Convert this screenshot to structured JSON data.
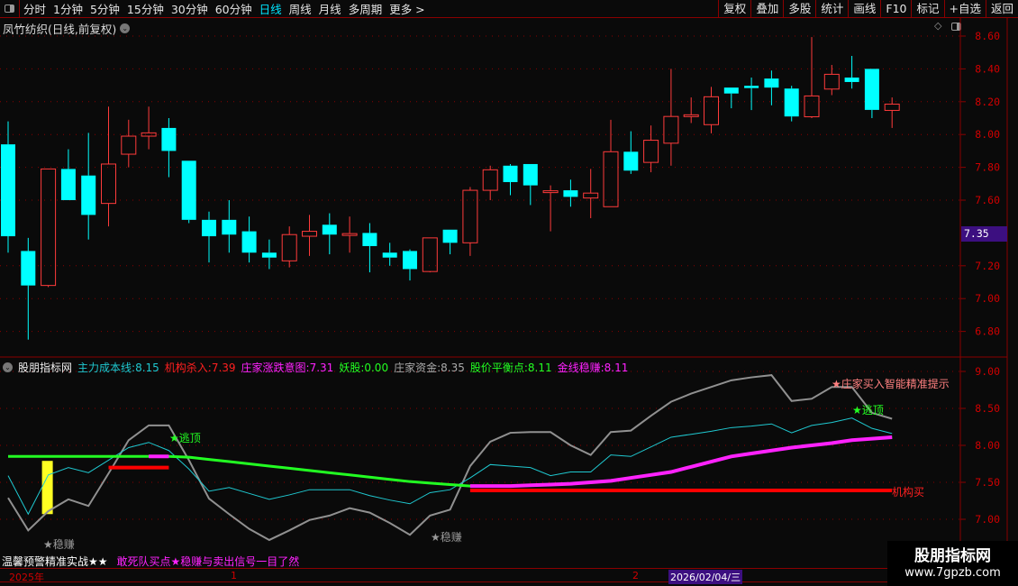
{
  "toolbar": {
    "periods": [
      "分时",
      "1分钟",
      "5分钟",
      "15分钟",
      "30分钟",
      "60分钟",
      "日线",
      "周线",
      "月线",
      "多周期",
      "更多 >"
    ],
    "active_period": "日线",
    "buttons": [
      "复权",
      "叠加",
      "多股",
      "统计",
      "画线",
      "F10",
      "标记",
      "+自选",
      "返回"
    ]
  },
  "chart_title": "凤竹纺织(日线,前复权)",
  "current_price_label": "7.35",
  "colors": {
    "up": "#ff3b3b",
    "down": "#00ffff",
    "grid": "#8a0000",
    "axis_text": "#d00000"
  },
  "indicator": {
    "name": "股朋指标网",
    "readouts": [
      {
        "label": "主力成本线:",
        "value": "8.15",
        "color": "#1fc8d0"
      },
      {
        "label": "机构杀入:",
        "value": "7.39",
        "color": "#ff2020"
      },
      {
        "label": "庄家涨跌意图:",
        "value": "7.31",
        "color": "#ff22ff"
      },
      {
        "label": "妖股:",
        "value": "0.00",
        "color": "#22ff22"
      },
      {
        "label": "庄家资金:",
        "value": "8.35",
        "color": "#aaaaaa"
      },
      {
        "label": "股价平衡点:",
        "value": "8.11",
        "color": "#22ff22"
      },
      {
        "label": "金线稳赚:",
        "value": "8.11",
        "color": "#ff22ff"
      }
    ],
    "annotations": {
      "escape_top_1": "★逃顶",
      "escape_top_2": "★逃顶",
      "steady_1": "★稳赚",
      "steady_2": "★稳赚",
      "banker_buy": "★庄家买入智能精准提示",
      "inst_buy": "机构买"
    }
  },
  "bottom": {
    "left": "温馨预警精准实战★★",
    "right": "敢死队买点★稳赚与卖出信号一目了然"
  },
  "timeline": {
    "year": "2025年",
    "m1": "1",
    "m2": "2",
    "cursor_date": "2026/02/04/三"
  },
  "watermark": {
    "name": "股朋指标网",
    "url": "www.7gpzb.com"
  },
  "chart_data": [
    {
      "type": "candlestick",
      "title": "凤竹纺织(日线,前复权)",
      "yticks": [
        "8.60",
        "8.40",
        "8.20",
        "8.00",
        "7.80",
        "7.60",
        "7.20",
        "7.00",
        "6.80"
      ],
      "ylim": [
        6.75,
        8.62
      ],
      "ohlc": [
        [
          7.94,
          8.08,
          7.28,
          7.38
        ],
        [
          7.29,
          7.37,
          6.75,
          7.08
        ],
        [
          7.08,
          7.79,
          7.07,
          7.79
        ],
        [
          7.79,
          7.91,
          7.6,
          7.6
        ],
        [
          7.75,
          8.01,
          7.36,
          7.51
        ],
        [
          7.58,
          8.17,
          7.44,
          7.82
        ],
        [
          7.88,
          8.09,
          7.8,
          7.99
        ],
        [
          7.99,
          8.17,
          7.91,
          8.01
        ],
        [
          8.04,
          8.1,
          7.74,
          7.9
        ],
        [
          7.84,
          7.84,
          7.46,
          7.48
        ],
        [
          7.48,
          7.53,
          7.22,
          7.38
        ],
        [
          7.48,
          7.6,
          7.28,
          7.39
        ],
        [
          7.41,
          7.5,
          7.22,
          7.28
        ],
        [
          7.28,
          7.36,
          7.18,
          7.25
        ],
        [
          7.23,
          7.44,
          7.19,
          7.39
        ],
        [
          7.38,
          7.51,
          7.26,
          7.41
        ],
        [
          7.45,
          7.52,
          7.27,
          7.39
        ],
        [
          7.385,
          7.5,
          7.28,
          7.396
        ],
        [
          7.4,
          7.46,
          7.16,
          7.32
        ],
        [
          7.28,
          7.34,
          7.2,
          7.25
        ],
        [
          7.29,
          7.3,
          7.11,
          7.18
        ],
        [
          7.165,
          7.37,
          7.16,
          7.37
        ],
        [
          7.42,
          7.42,
          7.27,
          7.34
        ],
        [
          7.34,
          7.68,
          7.26,
          7.66
        ],
        [
          7.66,
          7.81,
          7.6,
          7.785
        ],
        [
          7.81,
          7.82,
          7.63,
          7.71
        ],
        [
          7.82,
          7.82,
          7.57,
          7.69
        ],
        [
          7.646,
          7.69,
          7.41,
          7.657
        ],
        [
          7.66,
          7.725,
          7.56,
          7.62
        ],
        [
          7.613,
          7.79,
          7.49,
          7.643
        ],
        [
          7.56,
          8.09,
          7.56,
          7.895
        ],
        [
          7.895,
          8.02,
          7.76,
          7.78
        ],
        [
          7.83,
          8.055,
          7.77,
          7.965
        ],
        [
          7.947,
          8.4,
          7.81,
          8.11
        ],
        [
          8.11,
          8.226,
          8.07,
          8.12
        ],
        [
          8.06,
          8.29,
          8.007,
          8.23
        ],
        [
          8.286,
          8.286,
          8.16,
          8.25
        ],
        [
          8.297,
          8.347,
          8.149,
          8.283
        ],
        [
          8.341,
          8.39,
          8.178,
          8.286
        ],
        [
          8.28,
          8.297,
          8.08,
          8.11
        ],
        [
          8.108,
          8.594,
          8.1,
          8.235
        ],
        [
          8.277,
          8.424,
          8.24,
          8.367
        ],
        [
          8.347,
          8.479,
          8.28,
          8.32
        ],
        [
          8.4,
          8.4,
          8.1,
          8.15
        ],
        [
          8.147,
          8.226,
          8.04,
          8.185
        ]
      ]
    },
    {
      "type": "line",
      "title": "股朋指标网",
      "yticks": [
        "9.00",
        "8.50",
        "8.00",
        "7.50",
        "7.00"
      ],
      "ylim": [
        6.7,
        9.0
      ],
      "series": [
        {
          "name": "庄家资金",
          "color": "#909090",
          "values": [
            7.29,
            6.85,
            7.11,
            7.27,
            7.18,
            7.62,
            8.07,
            8.27,
            8.27,
            7.8,
            7.28,
            7.07,
            6.87,
            6.72,
            6.85,
            6.99,
            7.05,
            7.15,
            7.09,
            6.95,
            6.79,
            7.05,
            7.13,
            7.72,
            8.05,
            8.17,
            8.18,
            8.18,
            8.0,
            7.87,
            8.18,
            8.2,
            8.4,
            8.59,
            8.7,
            8.79,
            8.88,
            8.92,
            8.95,
            8.6,
            8.63,
            8.79,
            8.79,
            8.44,
            8.36
          ]
        },
        {
          "name": "主力成本线",
          "color": "#1fc8d0",
          "values": [
            7.59,
            7.07,
            7.6,
            7.7,
            7.63,
            7.8,
            7.97,
            8.04,
            7.93,
            7.68,
            7.38,
            7.43,
            7.35,
            7.27,
            7.33,
            7.4,
            7.4,
            7.4,
            7.32,
            7.26,
            7.21,
            7.36,
            7.4,
            7.56,
            7.74,
            7.72,
            7.7,
            7.59,
            7.64,
            7.64,
            7.87,
            7.85,
            7.98,
            8.11,
            8.15,
            8.19,
            8.24,
            8.26,
            8.29,
            8.17,
            8.27,
            8.31,
            8.37,
            8.23,
            8.16
          ]
        },
        {
          "name": "股价平衡点",
          "color": "#22ff22",
          "alt_color": "#ff22ff",
          "alt_ranges": [
            [
              7,
              8
            ],
            [
              23,
              44
            ]
          ],
          "values": [
            7.85,
            7.85,
            7.85,
            7.85,
            7.85,
            7.85,
            7.85,
            7.85,
            7.85,
            7.84,
            7.81,
            7.78,
            7.75,
            7.72,
            7.69,
            7.66,
            7.63,
            7.6,
            7.57,
            7.54,
            7.51,
            7.49,
            7.47,
            7.45,
            7.45,
            7.45,
            7.46,
            7.47,
            7.48,
            7.5,
            7.52,
            7.56,
            7.6,
            7.64,
            7.71,
            7.78,
            7.85,
            7.89,
            7.93,
            7.97,
            8.0,
            8.03,
            8.07,
            8.09,
            8.11
          ]
        },
        {
          "name": "机构杀入",
          "color": "#ff0000",
          "segments": [
            {
              "from": 5,
              "to": 8,
              "value": 7.7
            },
            {
              "from": 23,
              "to": 44,
              "value": 7.39
            }
          ]
        }
      ],
      "bar": {
        "index": 2,
        "from": 7.07,
        "to": 7.79,
        "color": "#ffff22"
      }
    }
  ]
}
